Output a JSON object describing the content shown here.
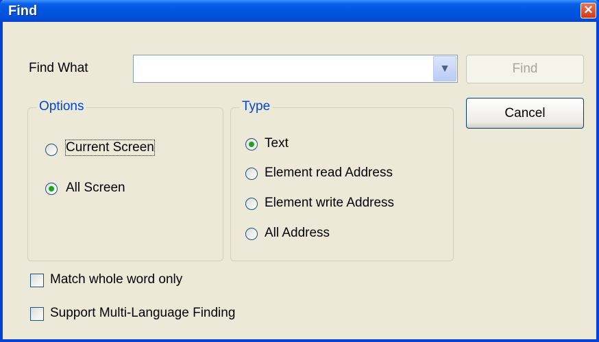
{
  "window": {
    "title": "Find"
  },
  "find_what": {
    "label": "Find What",
    "value": ""
  },
  "buttons": {
    "find": "Find",
    "cancel": "Cancel"
  },
  "options": {
    "title": "Options",
    "items": [
      {
        "label": "Current Screen",
        "checked": false
      },
      {
        "label": "All Screen",
        "checked": true
      }
    ]
  },
  "type": {
    "title": "Type",
    "items": [
      {
        "label": "Text",
        "checked": true
      },
      {
        "label": "Element read Address",
        "checked": false
      },
      {
        "label": "Element write Address",
        "checked": false
      },
      {
        "label": "All Address",
        "checked": false
      }
    ]
  },
  "checkboxes": [
    {
      "label": "Match whole word only",
      "checked": false
    },
    {
      "label": "Support Multi-Language Finding",
      "checked": false
    }
  ],
  "icons": {
    "close": "close-icon",
    "dropdown": "chevron-down-icon"
  }
}
